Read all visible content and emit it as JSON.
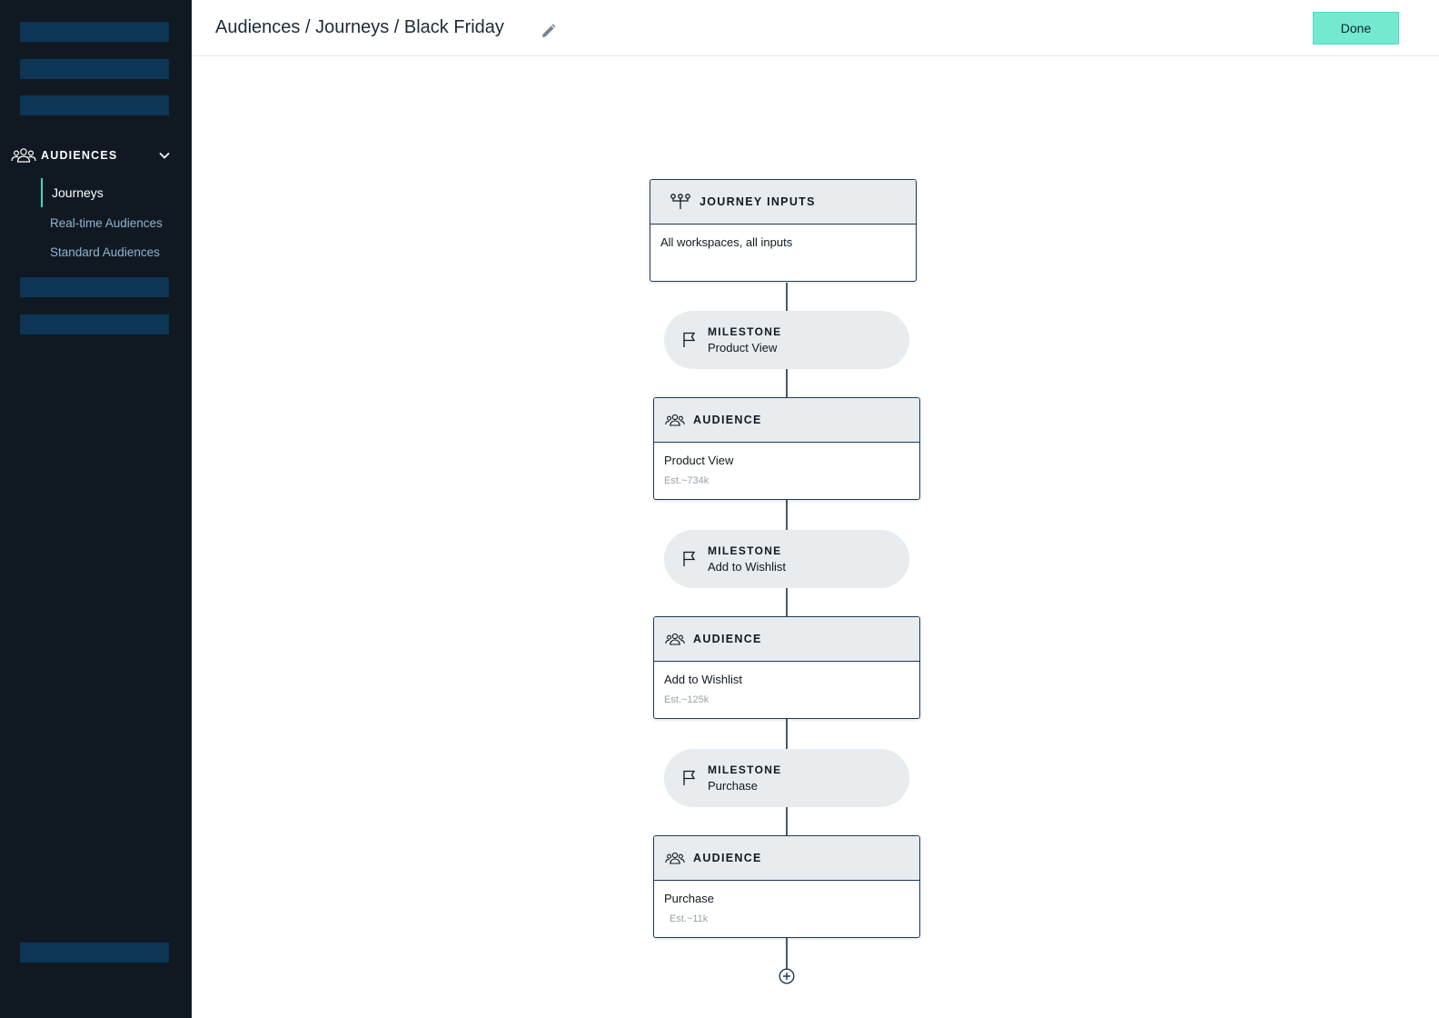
{
  "sidebar": {
    "section": {
      "label": "AUDIENCES",
      "icon": "people-icon",
      "expanded": true
    },
    "items": [
      {
        "label": "Journeys",
        "active": true
      },
      {
        "label": "Real-time Audiences",
        "active": false
      },
      {
        "label": "Standard Audiences",
        "active": false
      }
    ]
  },
  "header": {
    "breadcrumb": "Audiences / Journeys / Black Friday",
    "edit_icon": "pencil-icon",
    "done_label": "Done"
  },
  "flow": {
    "inputs": {
      "title": "JOURNEY INPUTS",
      "icon": "inputs-icon",
      "text": "All workspaces, all inputs"
    },
    "milestones": [
      {
        "label": "MILESTONE",
        "name": "Product View",
        "icon": "flag-icon"
      },
      {
        "label": "MILESTONE",
        "name": "Add to Wishlist",
        "icon": "flag-icon"
      },
      {
        "label": "MILESTONE",
        "name": "Purchase",
        "icon": "flag-icon"
      }
    ],
    "audiences": [
      {
        "title": "AUDIENCE",
        "name": "Product View",
        "estimate": "Est.~734k",
        "icon": "people-icon"
      },
      {
        "title": "AUDIENCE",
        "name": "Add to Wishlist",
        "estimate": "Est.~125k",
        "icon": "people-icon"
      },
      {
        "title": "AUDIENCE",
        "name": "Purchase",
        "estimate": "Est.~11k",
        "icon": "people-icon"
      }
    ],
    "add_icon": "plus-circle-icon"
  },
  "colors": {
    "sidebar_bg": "#101922",
    "placeholder_bar": "#0c3556",
    "accent": "#3fd9c3",
    "done_button": "#73ead0",
    "node_header_bg": "#e8ecef",
    "node_border": "#1e3a55"
  }
}
